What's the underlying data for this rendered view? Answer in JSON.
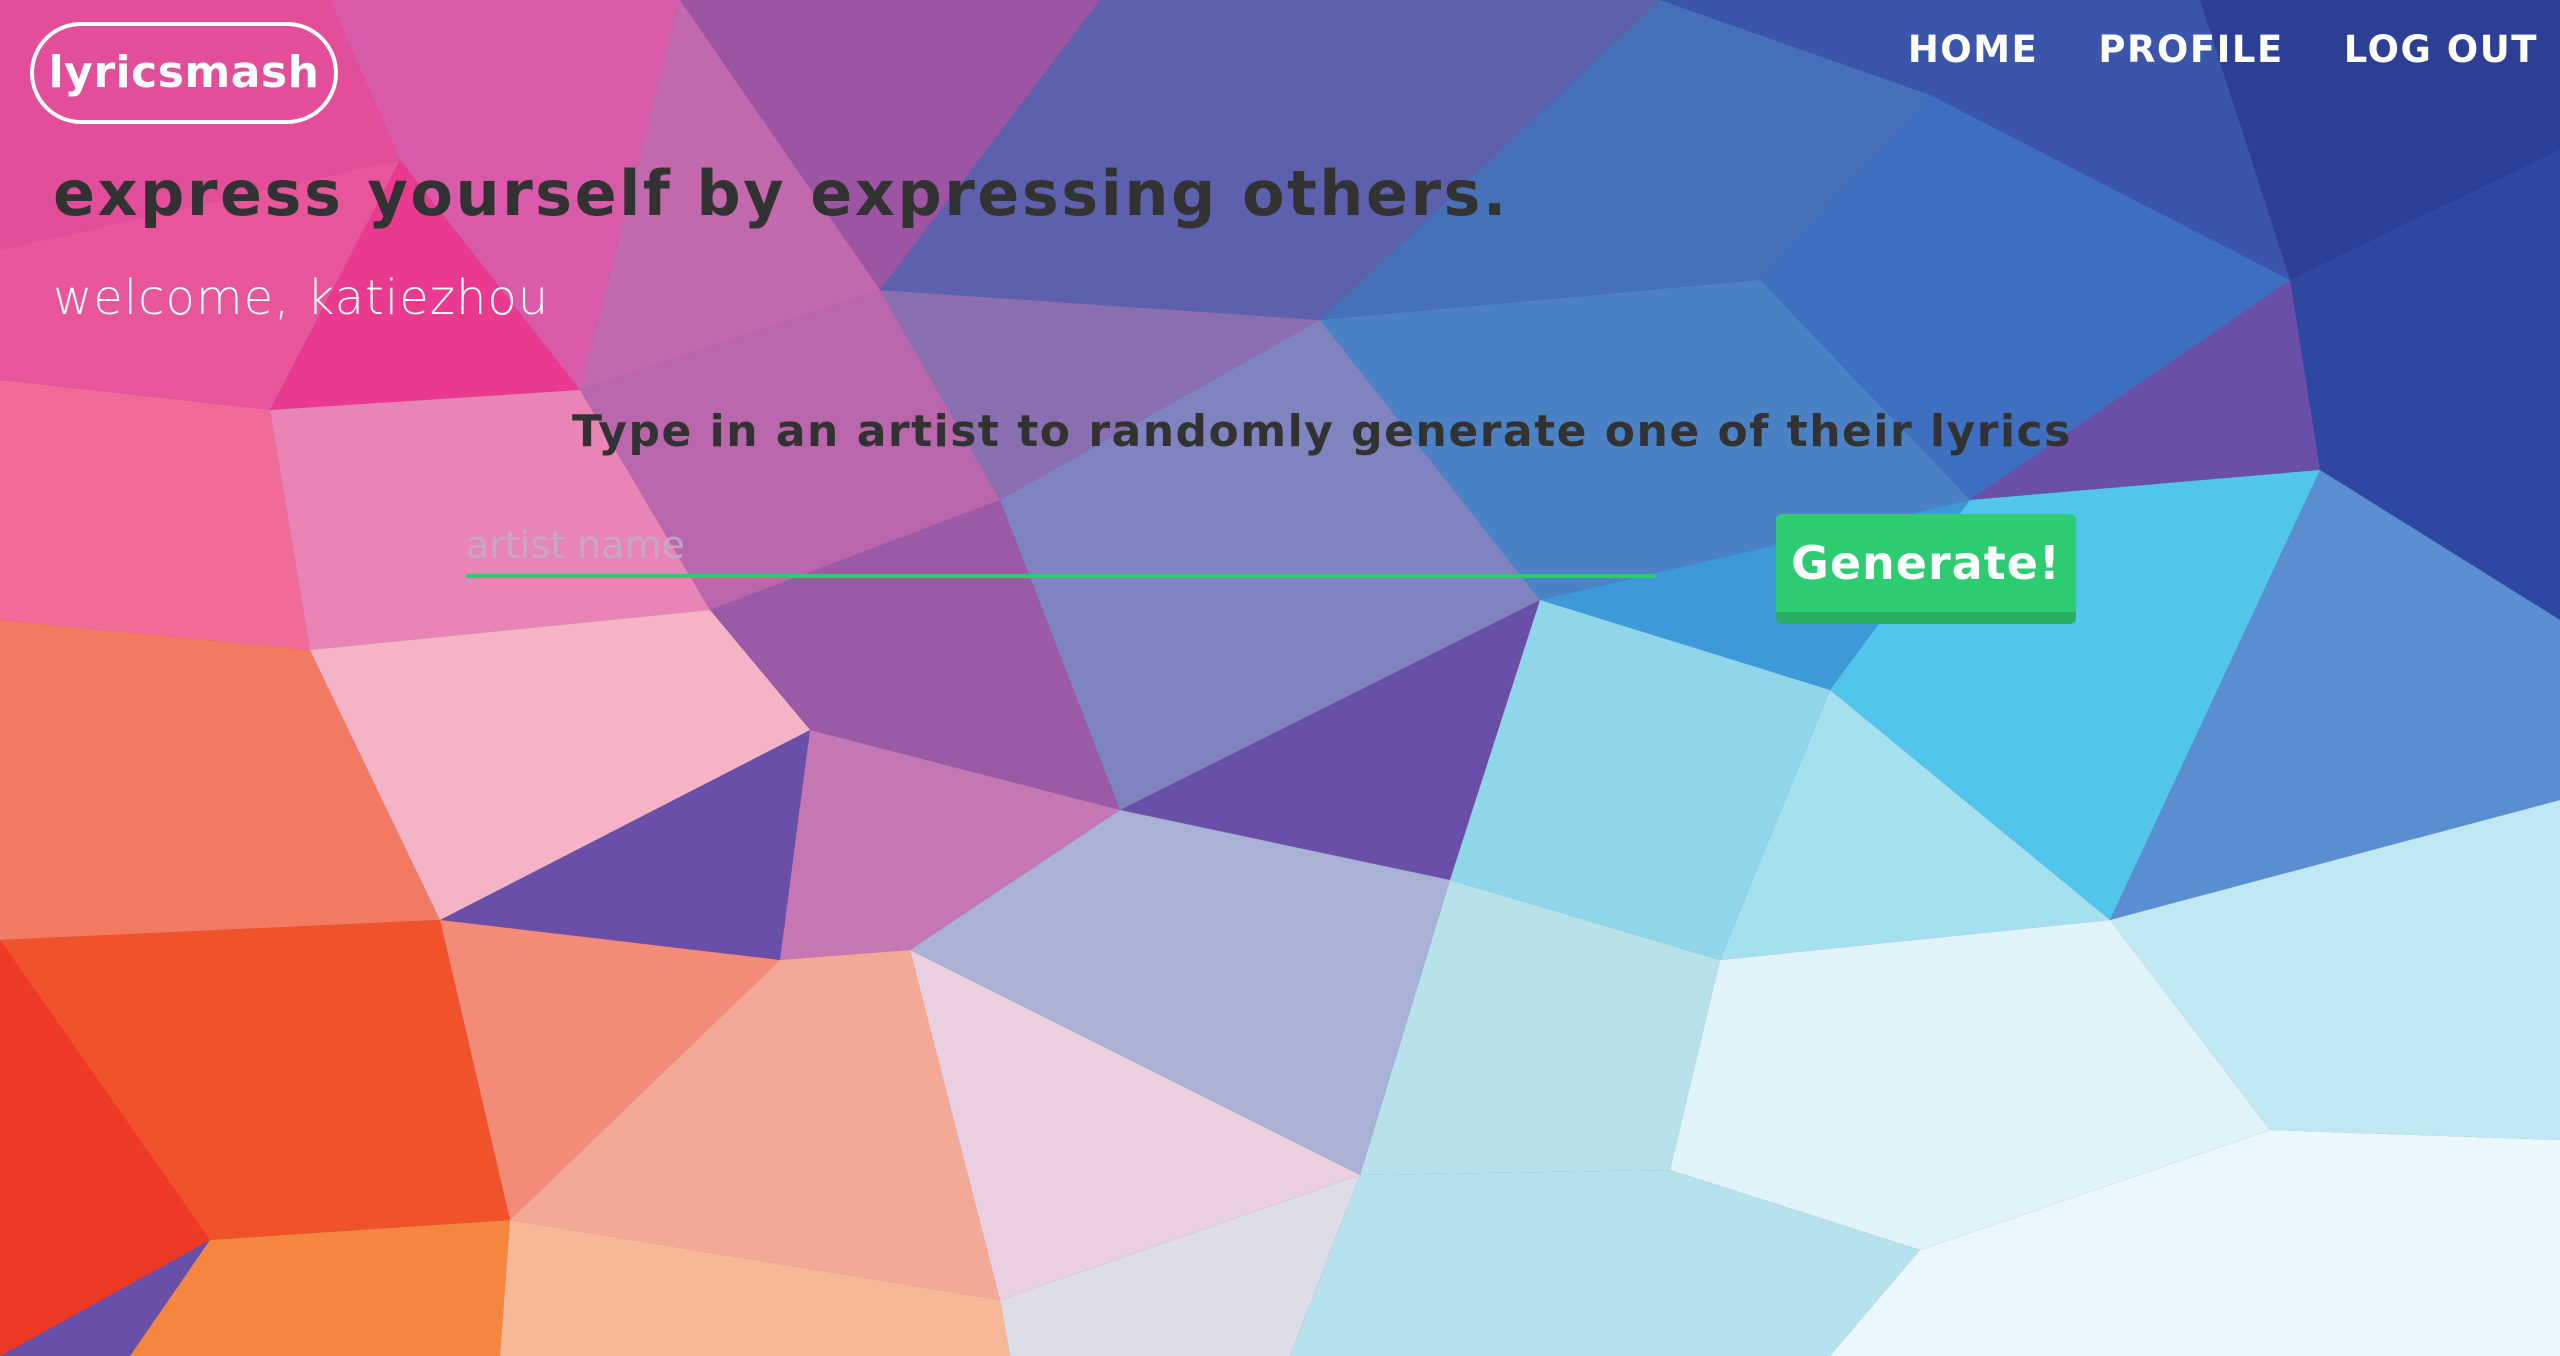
{
  "header": {
    "logo_text": "lyricsmash",
    "nav": [
      {
        "label": "HOME"
      },
      {
        "label": "PROFILE"
      },
      {
        "label": "LOG OUT"
      }
    ]
  },
  "main": {
    "tagline": "express yourself by expressing others.",
    "welcome": "welcome, katiezhou",
    "prompt": "Type in an artist to randomly generate one of their lyrics",
    "artist_input": {
      "value": "",
      "placeholder": "artist name"
    },
    "generate_label": "Generate!"
  },
  "colors": {
    "accent_green": "#2ecc71",
    "accent_green_dark": "#27ae60",
    "heading_text": "#333233",
    "light_text": "#ffffff"
  }
}
